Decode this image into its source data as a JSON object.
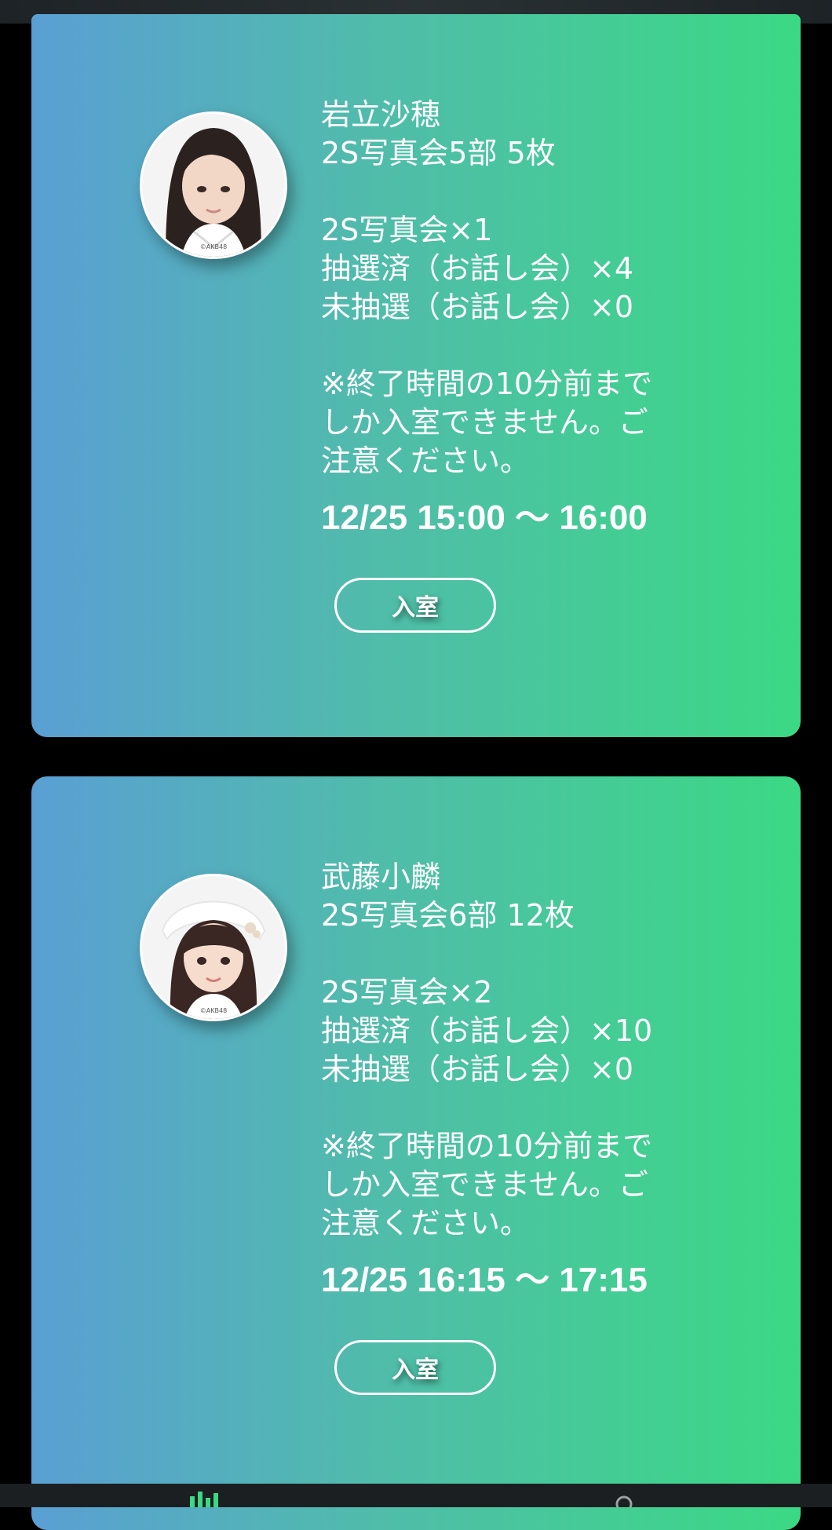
{
  "cards": [
    {
      "name": "岩立沙穂",
      "event": "2S写真会5部 5枚",
      "count_photo": "2S写真会×1",
      "count_drawn": "抽選済（お話し会）×4",
      "count_undrawn": "未抽選（お話し会）×0",
      "notice_1": "※終了時間の10分前まで",
      "notice_2": "しか入室できません。ご",
      "notice_3": "注意ください。",
      "time": "12/25 15:00 〜 16:00",
      "button": "入室",
      "avatar_credit": "©AKB48"
    },
    {
      "name": "武藤小麟",
      "event": "2S写真会6部 12枚",
      "count_photo": "2S写真会×2",
      "count_drawn": "抽選済（お話し会）×10",
      "count_undrawn": "未抽選（お話し会）×0",
      "notice_1": "※終了時間の10分前まで",
      "notice_2": "しか入室できません。ご",
      "notice_3": "注意ください。",
      "time": "12/25 16:15 〜 17:15",
      "button": "入室",
      "avatar_credit": "©AKB48"
    }
  ],
  "colors": {
    "gradient_left": "#5a9fd4",
    "gradient_right": "#3bd984",
    "background": "#000000",
    "tab_active": "#3bd984"
  },
  "icons": {
    "tab_left": "ticket-icon",
    "tab_right": "profile-icon"
  }
}
